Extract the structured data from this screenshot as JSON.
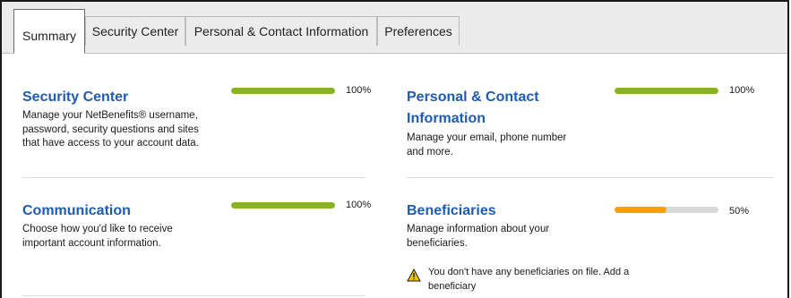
{
  "tabs": [
    {
      "label": "Summary",
      "active": true
    },
    {
      "label": "Security Center",
      "active": false
    },
    {
      "label": "Personal & Contact Information",
      "active": false
    },
    {
      "label": "Preferences",
      "active": false
    }
  ],
  "cards": {
    "security": {
      "title": "Security Center",
      "description": "Manage your NetBenefits® username, password, security questions and sites that have access to your account data.",
      "progress": 100,
      "progress_label": "100%"
    },
    "personal": {
      "title_line1": "Personal & Contact",
      "title_line2": "Information",
      "description": "Manage your email, phone number and more.",
      "progress": 100,
      "progress_label": "100%"
    },
    "communication": {
      "title": "Communication",
      "description": "Choose how you'd like to receive important account information.",
      "progress": 100,
      "progress_label": "100%"
    },
    "beneficiaries": {
      "title": "Beneficiaries",
      "description": "Manage information about your beneficiaries.",
      "progress": 50,
      "progress_label": "50%",
      "warning": "You don't have any beneficiaries on file. Add a beneficiary"
    }
  },
  "colors": {
    "link_blue": "#1e5cb3",
    "progress_green": "#8ab21d",
    "progress_orange": "#f5a300",
    "track_gray": "#d9d9d9",
    "warning_yellow": "#f2c200"
  },
  "icons": {
    "warning": "warning-triangle-icon"
  }
}
